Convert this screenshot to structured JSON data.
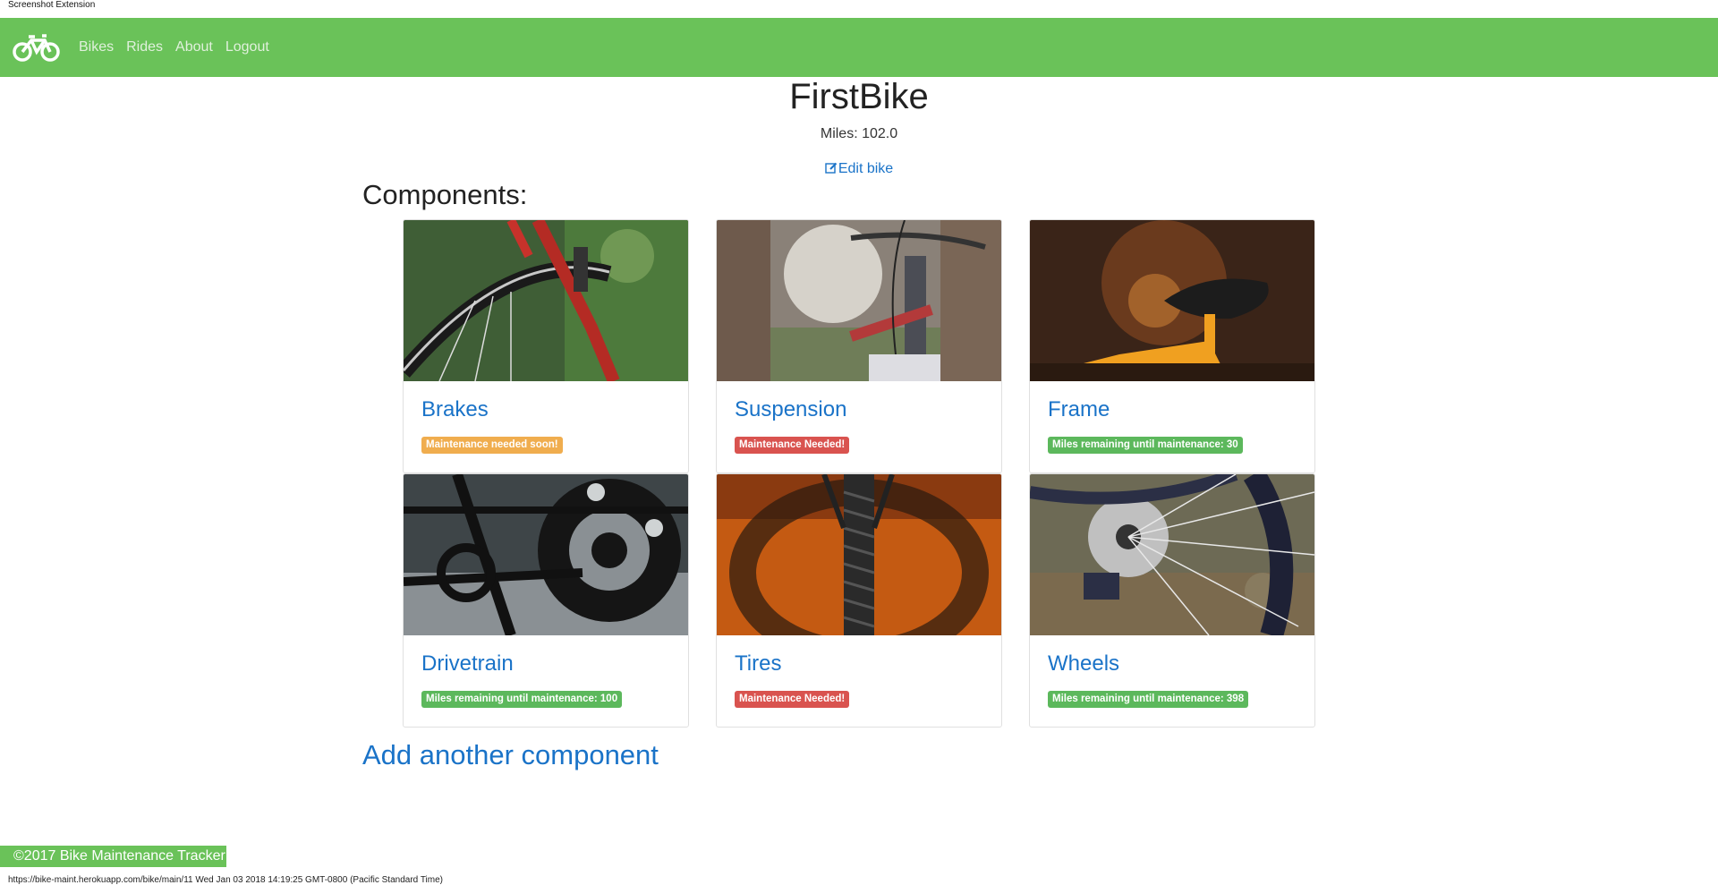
{
  "extension_label": "Screenshot Extension",
  "navbar": {
    "brand_icon": "bicycle-icon",
    "links": [
      "Bikes",
      "Rides",
      "About",
      "Logout"
    ]
  },
  "bike": {
    "name": "FirstBike",
    "miles": "Miles: 102.0",
    "edit_label": "Edit bike",
    "edit_icon": "edit-icon"
  },
  "components_heading": "Components:",
  "components": [
    {
      "name": "Brakes",
      "status": "Maintenance needed soon!",
      "status_color": "#f0ad4e"
    },
    {
      "name": "Suspension",
      "status": "Maintenance Needed!",
      "status_color": "#d9534f"
    },
    {
      "name": "Frame",
      "status": "Miles remaining until maintenance: 30",
      "status_color": "#5cb85c"
    },
    {
      "name": "Drivetrain",
      "status": "Miles remaining until maintenance: 100",
      "status_color": "#5cb85c"
    },
    {
      "name": "Tires",
      "status": "Maintenance Needed!",
      "status_color": "#d9534f"
    },
    {
      "name": "Wheels",
      "status": "Miles remaining until maintenance: 398",
      "status_color": "#5cb85c"
    }
  ],
  "add_component_label": "Add another component",
  "footer": "©2017 Bike Maintenance Tracker",
  "status_url": "https://bike-maint.herokuapp.com/bike/main/11 Wed Jan 03 2018 14:19:25 GMT-0800 (Pacific Standard Time)",
  "colors": {
    "nav": "#6ac259",
    "link": "#1a73c8"
  }
}
